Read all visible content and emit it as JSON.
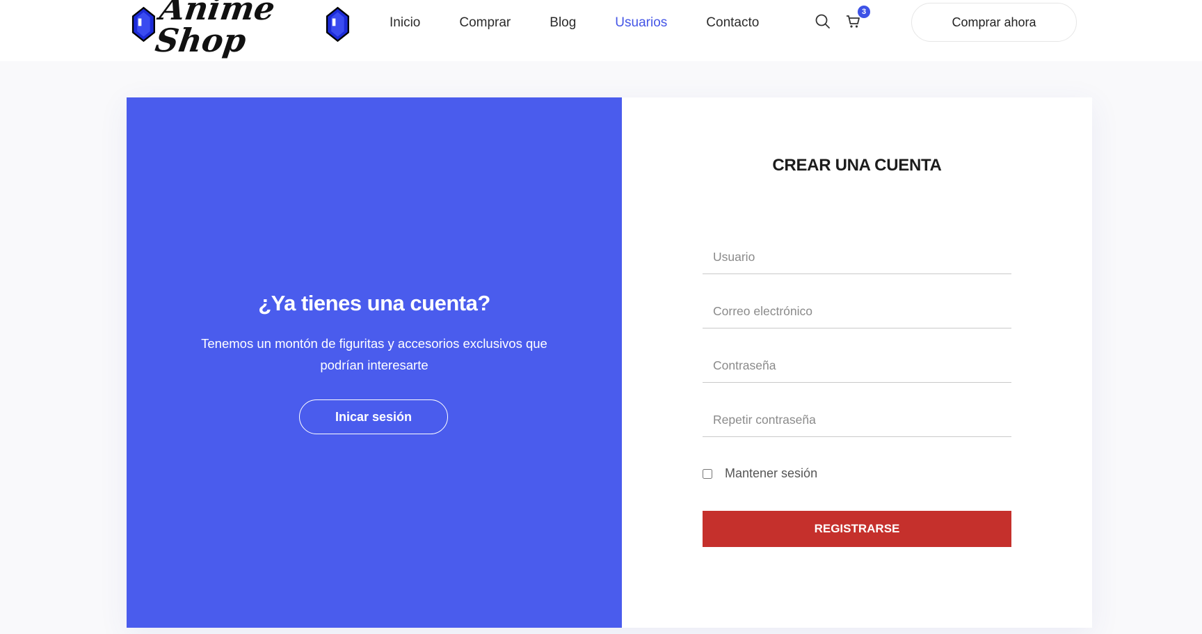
{
  "header": {
    "logo_text": "Anime Shop",
    "nav": [
      "Inicio",
      "Comprar",
      "Blog",
      "Usuarios",
      "Contacto"
    ],
    "active_nav": "Usuarios",
    "search_icon": "search-icon",
    "cart_icon": "cart-icon",
    "cart_count": "3",
    "cta_label": "Comprar ahora"
  },
  "left_panel": {
    "title": "¿Ya tienes una cuenta?",
    "text": "Tenemos un montón de figuritas y accesorios exclusivos que podrían interesarte",
    "login_label": "Inicar sesión"
  },
  "form": {
    "title": "CREAR UNA CUENTA",
    "username_placeholder": "Usuario",
    "email_placeholder": "Correo electrónico",
    "password_placeholder": "Contraseña",
    "repeat_password_placeholder": "Repetir contraseña",
    "remember_label": "Mantener sesión",
    "register_label": "REGISTRARSE"
  },
  "colors": {
    "accent": "#4a5ced",
    "nav_active": "#4455e6",
    "register": "#c5302c"
  }
}
